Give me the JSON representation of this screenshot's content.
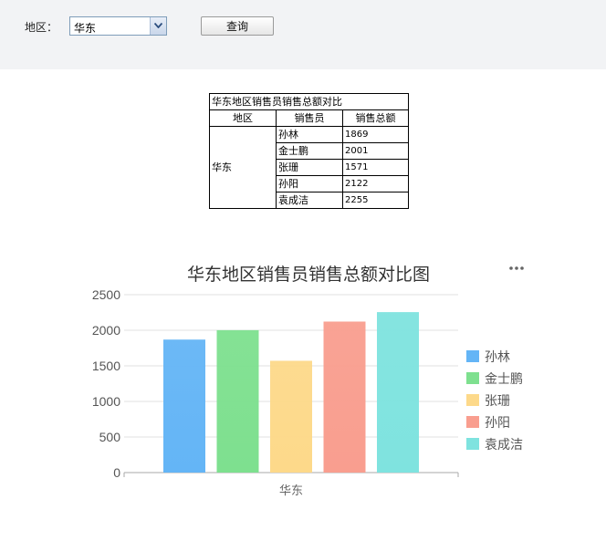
{
  "toolbar": {
    "region_label": "地区：",
    "region_value": "华东",
    "query_label": "查询"
  },
  "table": {
    "title": "华东地区销售员销售总额对比",
    "headers": [
      "地区",
      "销售员",
      "销售总额"
    ],
    "region": "华东",
    "rows": [
      {
        "name": "孙林",
        "total": "1869"
      },
      {
        "name": "金士鹏",
        "total": "2001"
      },
      {
        "name": "张珊",
        "total": "1571"
      },
      {
        "name": "孙阳",
        "total": "2122"
      },
      {
        "name": "袁成洁",
        "total": "2255"
      }
    ]
  },
  "chart_data": {
    "type": "bar",
    "title": "华东地区销售员销售总额对比图",
    "categories": [
      "华东"
    ],
    "series": [
      {
        "name": "孙林",
        "values": [
          1869
        ],
        "color": "#64b5f6"
      },
      {
        "name": "金士鹏",
        "values": [
          2001
        ],
        "color": "#7ee08f"
      },
      {
        "name": "张珊",
        "values": [
          1571
        ],
        "color": "#fdd98a"
      },
      {
        "name": "孙阳",
        "values": [
          2122
        ],
        "color": "#f99e8f"
      },
      {
        "name": "袁成洁",
        "values": [
          2255
        ],
        "color": "#7fe3df"
      }
    ],
    "ylim": [
      0,
      2500
    ],
    "yticks": [
      0,
      500,
      1000,
      1500,
      2000,
      2500
    ],
    "grid": true,
    "legend": "right",
    "menu_icon": "more-dots-icon"
  }
}
